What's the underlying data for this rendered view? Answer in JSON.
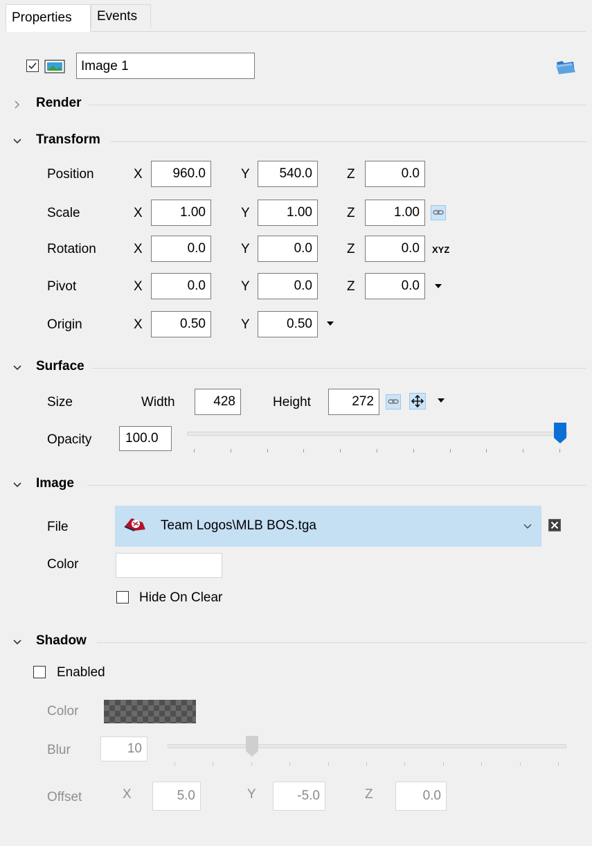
{
  "tabs": [
    {
      "label": "Properties",
      "active": true
    },
    {
      "label": "Events",
      "active": false
    }
  ],
  "layer": {
    "visible": true,
    "name": "Image 1"
  },
  "sections": {
    "render": {
      "title": "Render",
      "expanded": false
    },
    "transform": {
      "title": "Transform",
      "expanded": true,
      "rows": [
        {
          "label": "Position",
          "x": "960.0",
          "y": "540.0",
          "z": "0.0"
        },
        {
          "label": "Scale",
          "x": "1.00",
          "y": "1.00",
          "z": "1.00"
        },
        {
          "label": "Rotation",
          "x": "0.0",
          "y": "0.0",
          "z": "0.0",
          "order": "XYZ"
        },
        {
          "label": "Pivot",
          "x": "0.0",
          "y": "0.0",
          "z": "0.0"
        },
        {
          "label": "Origin",
          "x": "0.50",
          "y": "0.50"
        }
      ],
      "axes": {
        "x": "X",
        "y": "Y",
        "z": "Z"
      }
    },
    "surface": {
      "title": "Surface",
      "expanded": true,
      "size_label": "Size",
      "width_label": "Width",
      "width": "428",
      "height_label": "Height",
      "height": "272",
      "opacity_label": "Opacity",
      "opacity": "100.0",
      "opacity_level": 1.0
    },
    "image": {
      "title": "Image",
      "expanded": true,
      "file_label": "File",
      "file": "Team Logos\\MLB BOS.tga",
      "color_label": "Color",
      "color": "#ffffff",
      "hide_on_clear_label": "Hide On Clear",
      "hide_on_clear": false
    },
    "shadow": {
      "title": "Shadow",
      "expanded": true,
      "enabled_label": "Enabled",
      "enabled": false,
      "color_label": "Color",
      "blur_label": "Blur",
      "blur": "10",
      "blur_level": 0.2,
      "offset_label": "Offset",
      "offset": {
        "x": "5.0",
        "y": "-5.0",
        "z": "0.0"
      }
    }
  },
  "icons": {
    "open": "folder-icon",
    "link": "link-icon",
    "move": "move-arrows-icon",
    "clear": "clear-icon",
    "dropdown": "chevron-down-icon",
    "file_thumb": "logo-thumbnail-icon",
    "layer_type": "image-icon"
  },
  "colors": {
    "accent": "#0b6fd6",
    "selection": "#c5dff3",
    "toggle_on": "#cce4f7"
  }
}
